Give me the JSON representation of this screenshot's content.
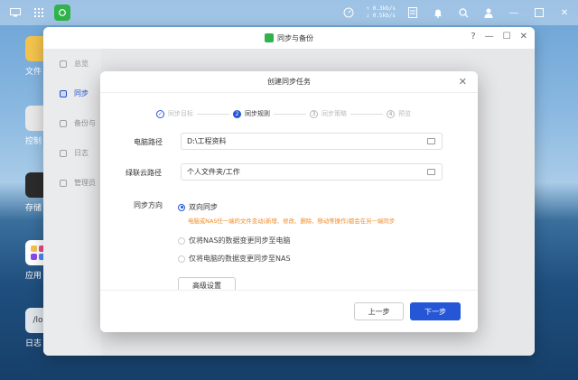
{
  "taskbar": {
    "upload_speed": "↑ 0.3kb/s",
    "download_speed": "↓ 0.5kb/s"
  },
  "desktop": {
    "icons": [
      {
        "label": "文件",
        "color": "#f3c34d"
      },
      {
        "label": "控制",
        "color": "#e8e8e8"
      },
      {
        "label": "存储",
        "color": "#2b2b2b"
      },
      {
        "label": "应用",
        "color": "#ffffff"
      },
      {
        "label": "日志",
        "color": "#dfe4ea"
      }
    ],
    "log_icon_text": "/lo"
  },
  "main_window": {
    "title": "同步与备份",
    "controls": {
      "help": "?",
      "minimize": "—",
      "maximize": "☐",
      "close": "✕"
    },
    "sidebar": [
      {
        "label": "总览",
        "active": false
      },
      {
        "label": "同步",
        "active": true
      },
      {
        "label": "备份与",
        "active": false
      },
      {
        "label": "日志",
        "active": false
      },
      {
        "label": "管理员",
        "active": false
      }
    ]
  },
  "dialog": {
    "title": "创建同步任务",
    "close": "✕",
    "steps": [
      {
        "index": "✓",
        "label": "同步目标",
        "state": "done"
      },
      {
        "index": "2",
        "label": "同步规则",
        "state": "active"
      },
      {
        "index": "3",
        "label": "同步策略",
        "state": "pending"
      },
      {
        "index": "4",
        "label": "预览",
        "state": "pending"
      }
    ],
    "pc_path_label": "电脑路径",
    "pc_path_value": "D:\\工程资料",
    "cloud_path_label": "绿联云路径",
    "cloud_path_value": "个人文件夹/工作",
    "direction_label": "同步方向",
    "options": [
      {
        "label": "双向同步",
        "checked": true
      },
      {
        "label": "仅将NAS的数据变更同步至电脑",
        "checked": false
      },
      {
        "label": "仅将电脑的数据变更同步至NAS",
        "checked": false
      }
    ],
    "hint": "电脑或NAS任一端的文件变动(新增、修改、删除、移动等操作)都会在另一端同步",
    "advanced_button": "高级设置",
    "prev_button": "上一步",
    "next_button": "下一步"
  },
  "colors": {
    "accent": "#2456d6",
    "hint": "#f08a24"
  }
}
